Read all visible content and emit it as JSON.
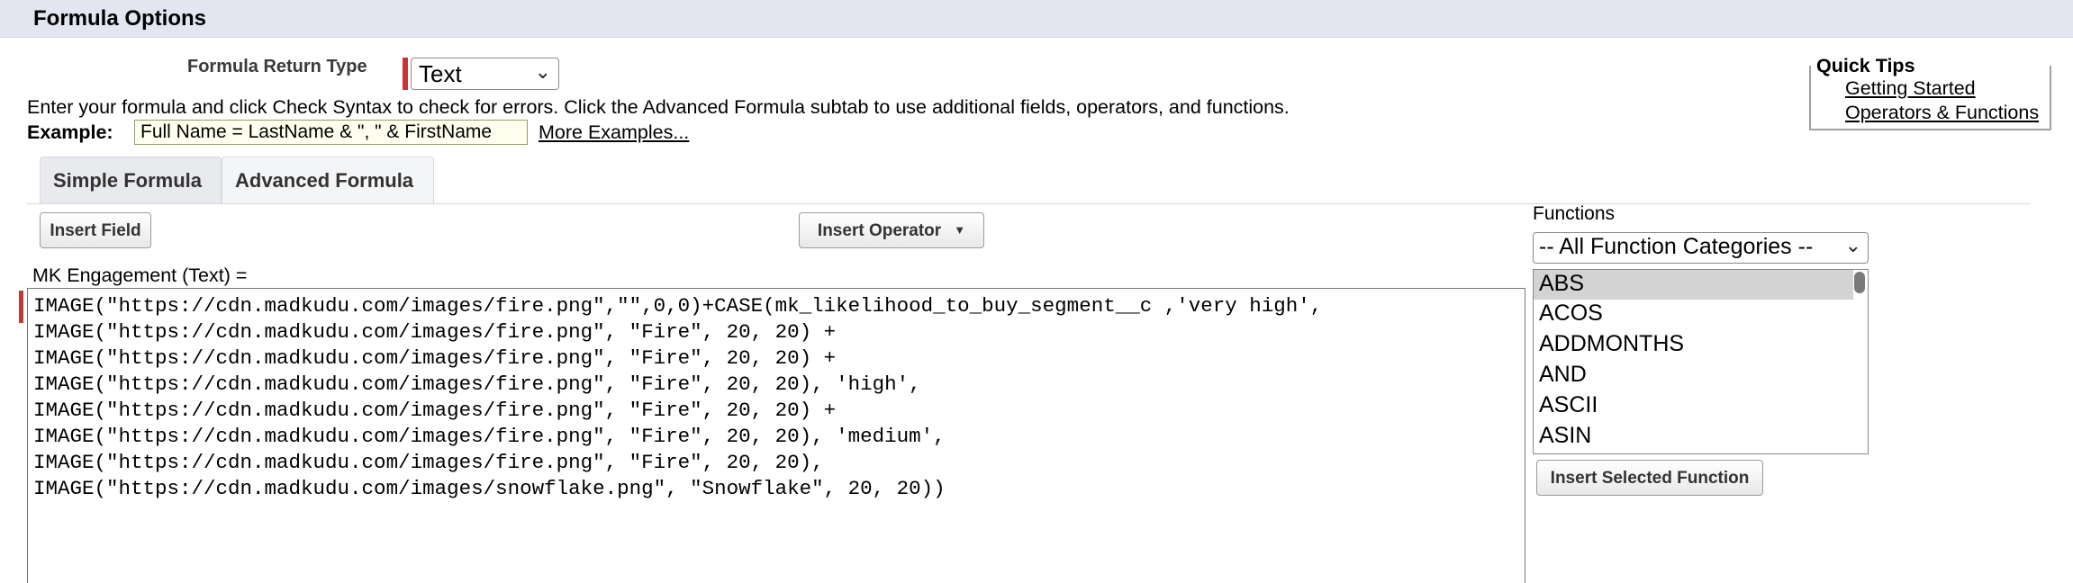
{
  "section_title": "Formula Options",
  "return_type": {
    "label": "Formula Return Type",
    "value": "Text"
  },
  "instructions": "Enter your formula and click Check Syntax to check for errors. Click the Advanced Formula subtab to use additional fields, operators, and functions.",
  "example": {
    "label": "Example:",
    "value": "Full Name = LastName & \", \" & FirstName",
    "more_link": "More Examples..."
  },
  "quick_tips": {
    "title": "Quick Tips",
    "links": [
      "Getting Started",
      "Operators & Functions"
    ]
  },
  "tabs": [
    {
      "label": "Simple Formula",
      "active": false
    },
    {
      "label": "Advanced Formula",
      "active": true
    }
  ],
  "toolbar": {
    "insert_field": "Insert Field",
    "insert_operator": "Insert Operator"
  },
  "formula": {
    "label": "MK Engagement (Text) =",
    "lines": [
      "IMAGE(\"https://cdn.madkudu.com/images/fire.png\",\"\",0,0)+CASE(mk_likelihood_to_buy_segment__c ,'very high',",
      "IMAGE(\"https://cdn.madkudu.com/images/fire.png\", \"Fire\", 20, 20) +",
      "IMAGE(\"https://cdn.madkudu.com/images/fire.png\", \"Fire\", 20, 20) +",
      "IMAGE(\"https://cdn.madkudu.com/images/fire.png\", \"Fire\", 20, 20), 'high',",
      "IMAGE(\"https://cdn.madkudu.com/images/fire.png\", \"Fire\", 20, 20) +",
      "IMAGE(\"https://cdn.madkudu.com/images/fire.png\", \"Fire\", 20, 20), 'medium',",
      "IMAGE(\"https://cdn.madkudu.com/images/fire.png\", \"Fire\", 20, 20),",
      "IMAGE(\"https://cdn.madkudu.com/images/snowflake.png\", \"Snowflake\", 20, 20))"
    ]
  },
  "functions": {
    "label": "Functions",
    "category": "-- All Function Categories --",
    "items": [
      "ABS",
      "ACOS",
      "ADDMONTHS",
      "AND",
      "ASCII",
      "ASIN"
    ],
    "selected": "ABS",
    "insert_button": "Insert Selected Function"
  },
  "colors": {
    "header_bg": "#e3e6f0",
    "required_marker": "#c23934",
    "selected_item_bg": "#d3d3d3"
  }
}
